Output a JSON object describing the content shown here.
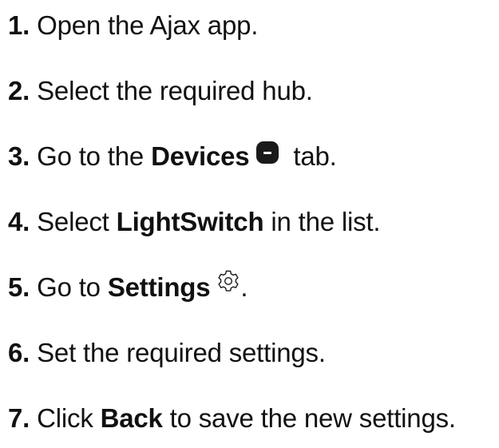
{
  "steps": [
    {
      "number": "1.",
      "text": "Open the Ajax app."
    },
    {
      "number": "2.",
      "text": "Select the required hub."
    },
    {
      "number": "3.",
      "pre": "Go to the ",
      "bold": "Devices",
      "icon": "devices-tab-icon",
      "post": " tab."
    },
    {
      "number": "4.",
      "pre": "Select ",
      "bold": "LightSwitch",
      "post": " in the list."
    },
    {
      "number": "5.",
      "pre": "Go to ",
      "bold": "Settings",
      "icon": "gear-icon",
      "post": "."
    },
    {
      "number": "6.",
      "text": "Set the required settings."
    },
    {
      "number": "7.",
      "pre": "Click ",
      "bold": "Back",
      "post": " to save the new settings."
    }
  ],
  "colors": {
    "text": "#111111",
    "icon_fill": "#1a1a1a",
    "background": "#ffffff"
  }
}
